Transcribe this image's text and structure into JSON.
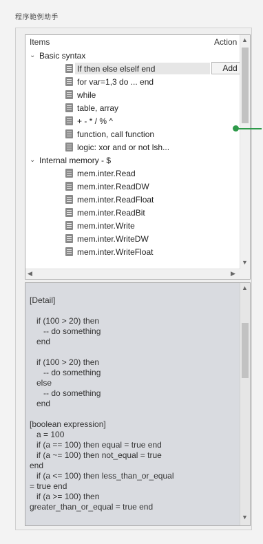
{
  "window": {
    "title": "程序範例助手"
  },
  "tree": {
    "header": {
      "items": "Items",
      "action": "Action"
    },
    "rows": [
      {
        "type": "group",
        "label": "Basic syntax"
      },
      {
        "type": "leaf",
        "label": "If then else elself end",
        "selected": true,
        "action": "Add"
      },
      {
        "type": "leaf",
        "label": "for var=1,3 do ... end"
      },
      {
        "type": "leaf",
        "label": "while"
      },
      {
        "type": "leaf",
        "label": "table, array"
      },
      {
        "type": "leaf",
        "label": "+ - * / % ^"
      },
      {
        "type": "leaf",
        "label": "function, call function"
      },
      {
        "type": "leaf",
        "label": "logic: xor and or not lsh..."
      },
      {
        "type": "group",
        "label": "Internal memory - $"
      },
      {
        "type": "leaf",
        "label": "mem.inter.Read"
      },
      {
        "type": "leaf",
        "label": "mem.inter.ReadDW"
      },
      {
        "type": "leaf",
        "label": "mem.inter.ReadFloat"
      },
      {
        "type": "leaf",
        "label": "mem.inter.ReadBit"
      },
      {
        "type": "leaf",
        "label": "mem.inter.Write"
      },
      {
        "type": "leaf",
        "label": "mem.inter.WriteDW"
      },
      {
        "type": "leaf",
        "label": "mem.inter.WriteFloat"
      }
    ]
  },
  "detail": {
    "text": "[Detail]\n\n   if (100 > 20) then\n      -- do something\n   end\n\n   if (100 > 20) then\n      -- do something\n   else\n      -- do something\n   end\n\n[boolean expression]\n   a = 100\n   if (a == 100) then equal = true end\n   if (a ~= 100) then not_equal = true\nend\n   if (a <= 100) then less_than_or_equal\n= true end\n   if (a >= 100) then\ngreater_than_or_equal = true end"
  },
  "colors": {
    "marker": "#2e9a4a",
    "detail_bg": "#d9dbe0"
  }
}
